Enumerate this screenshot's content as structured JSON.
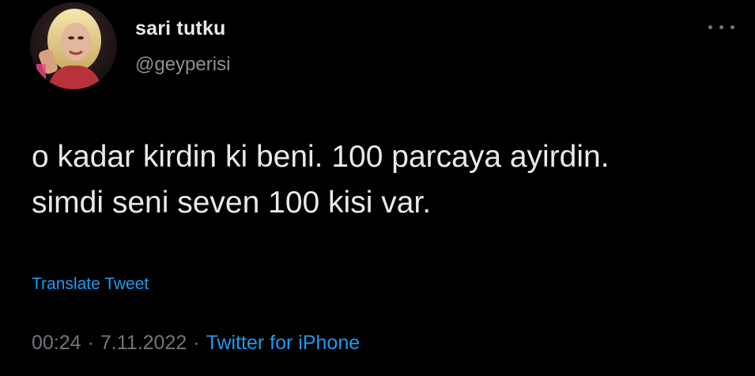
{
  "tweet": {
    "author": {
      "display_name": "sari tutku",
      "handle": "@geyperisi",
      "avatar_icon": "profile-photo-avatar"
    },
    "more_icon": "ellipsis-icon",
    "text_lines": [
      "o kadar kirdin ki beni. 100 parcaya ayirdin.",
      "simdi seni seven 100 kisi var."
    ],
    "translate_label": "Translate Tweet",
    "time": "00:24",
    "date": "7.11.2022",
    "separator": "·",
    "source": "Twitter for iPhone"
  },
  "colors": {
    "background": "#000000",
    "primary_text": "#e7e9ea",
    "secondary_text": "#71767b",
    "link": "#1d9bf0"
  }
}
